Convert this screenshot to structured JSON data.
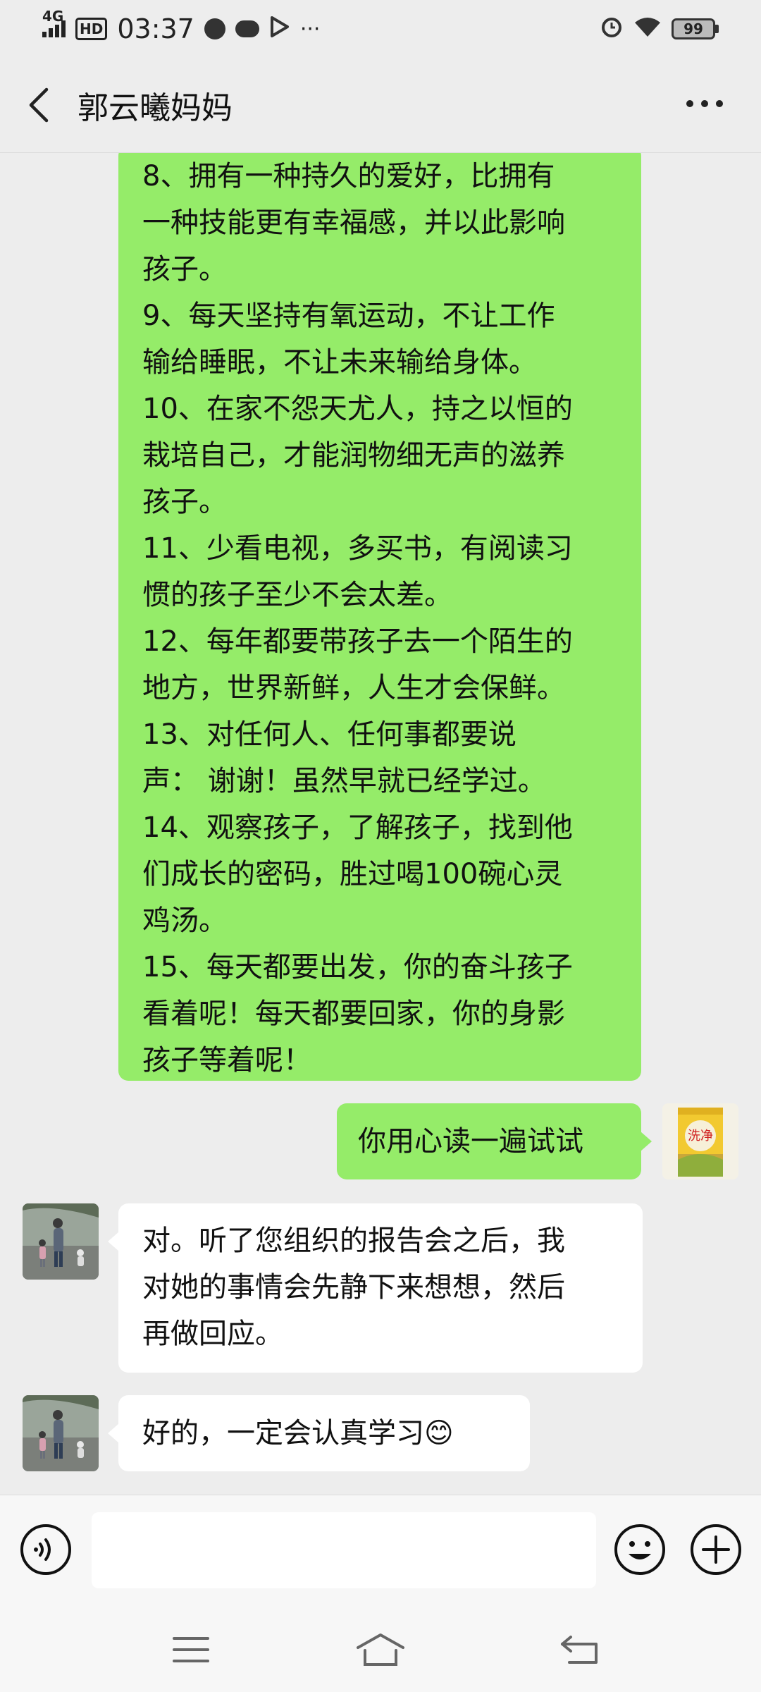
{
  "status_bar": {
    "network": "4G",
    "hd": "HD",
    "time": "03:37",
    "battery": "99",
    "more": "···"
  },
  "header": {
    "title": "郭云曦妈妈"
  },
  "messages": {
    "long_text_lines": [
      "8、拥有一种持久的爱好，比拥有",
      "一种技能更有幸福感，并以此影响",
      "孩子。",
      "9、每天坚持有氧运动，不让工作",
      "输给睡眠，不让未来输给身体。",
      "10、在家不怨天尤人，持之以恒的",
      "栽培自己，才能润物细无声的滋养",
      "孩子。",
      "11、少看电视，多买书，有阅读习",
      "惯的孩子至少不会太差。",
      "12、每年都要带孩子去一个陌生的",
      "地方，世界新鲜，人生才会保鲜。",
      "13、对任何人、任何事都要说",
      "声：  谢谢！虽然早就已经学过。",
      "14、观察孩子，了解孩子，找到他",
      "们成长的密码，胜过喝100碗心灵",
      "鸡汤。",
      "15、每天都要出发，你的奋斗孩子",
      "看着呢！每天都要回家，你的身影",
      "孩子等着呢！"
    ],
    "sent_short": "你用心读一遍试试",
    "reply1_lines": [
      "对。听了您组织的报告会之后，我",
      "对她的事情会先静下来想想，然后",
      "再做回应。"
    ],
    "reply2": "好的，一定会认真学习😊"
  },
  "sticker": {
    "brand_text": "洗净"
  },
  "input_bar": {
    "placeholder": ""
  },
  "colors": {
    "sent_bubble": "#95ec69",
    "received_bubble": "#ffffff",
    "background": "#ededed"
  }
}
